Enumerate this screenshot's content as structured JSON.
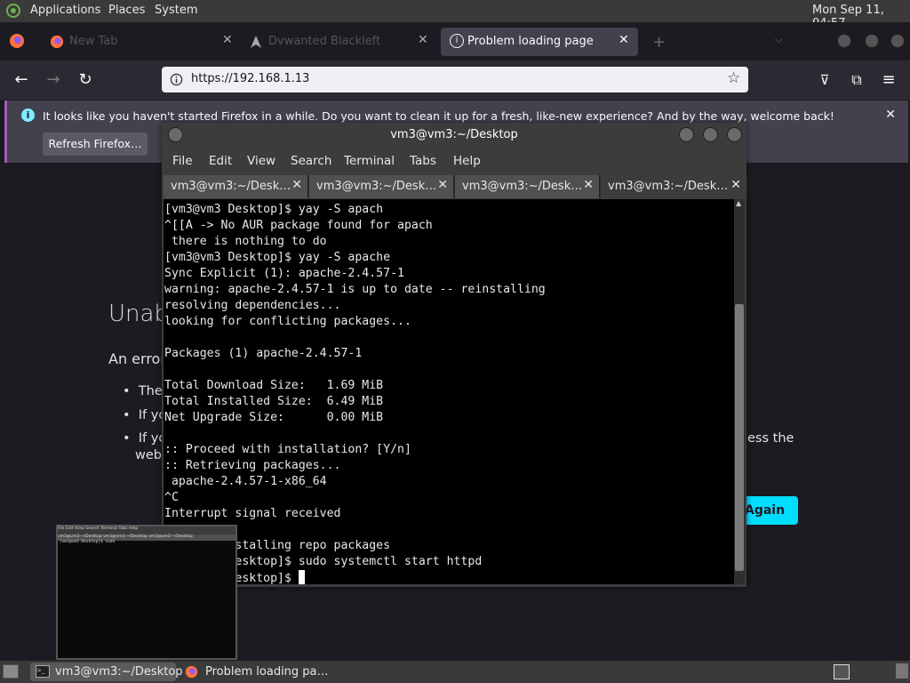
{
  "top_panel": {
    "menus": [
      "Applications",
      "Places",
      "System"
    ],
    "clock": "Mon Sep 11, 04:57"
  },
  "firefox": {
    "tabs": [
      {
        "label": "New Tab"
      },
      {
        "label": "Dvwanted Blackleft"
      },
      {
        "label": "Problem loading page"
      }
    ],
    "url": "https://192.168.1.13",
    "notification": {
      "message": "It looks like you haven't started Firefox in a while. Do you want to clean it up for a fresh, like-new experience? And by the way, welcome back!",
      "button": "Refresh Firefox…"
    },
    "page": {
      "title": "Unab",
      "intro": "An error",
      "bullets": [
        "The",
        "If yo",
        "If you",
        "web"
      ],
      "bullet_tail": "ess the",
      "try_again": "Again"
    }
  },
  "terminal": {
    "title": "vm3@vm3:~/Desktop",
    "menu": [
      "File",
      "Edit",
      "View",
      "Search",
      "Terminal",
      "Tabs",
      "Help"
    ],
    "tabs": [
      "vm3@vm3:~/Desk…",
      "vm3@vm3:~/Desk…",
      "vm3@vm3:~/Desk…",
      "vm3@vm3:~/Desk…"
    ],
    "lines": [
      "[vm3@vm3 Desktop]$ yay -S apach",
      "^[[A -> No AUR package found for apach",
      " there is nothing to do",
      "[vm3@vm3 Desktop]$ yay -S apache",
      "Sync Explicit (1): apache-2.4.57-1",
      "warning: apache-2.4.57-1 is up to date -- reinstalling",
      "resolving dependencies...",
      "looking for conflicting packages...",
      "",
      "Packages (1) apache-2.4.57-1",
      "",
      "Total Download Size:   1.69 MiB",
      "Total Installed Size:  6.49 MiB",
      "Net Upgrade Size:      0.00 MiB",
      "",
      ":: Proceed with installation? [Y/n]",
      ":: Retrieving packages...",
      " apache-2.4.57-1-x86_64",
      "^C",
      "Interrupt signal received",
      "",
      "        installing repo packages",
      "[vm3@vm3 Desktop]$ sudo systemctl start httpd",
      "[vm3@vm3 Desktop]$ "
    ]
  },
  "thumbnail": {
    "menu": "File  Edit  View  Search  Terminal  Tabs  Help",
    "tabs": "vm3@vm3:~/Desktop   vm3@vm3:~/Desktop   vm3@vm3:~/Desktop",
    "line": "[vm3@vm3 Desktop]$ sudo"
  },
  "taskbar": {
    "items": [
      "vm3@vm3:~/Desktop",
      "Problem loading pa…"
    ]
  }
}
